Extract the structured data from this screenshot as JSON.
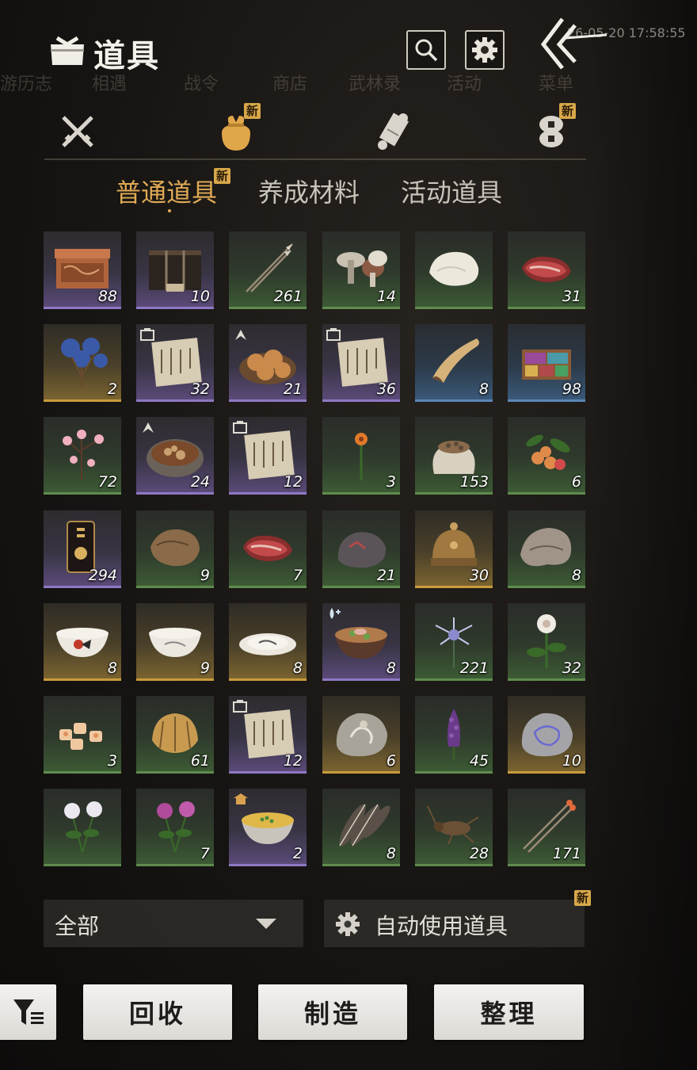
{
  "background": {
    "menu_labels": [
      "游历志",
      "相遇",
      "战令",
      "商店",
      "武林录",
      "活动",
      "菜单"
    ],
    "timestamp": "26-05-20 17:58:55"
  },
  "header": {
    "title": "道具",
    "search_icon": "search-icon",
    "settings_icon": "gear-icon",
    "back_icon": "back-chevron-icon"
  },
  "category_tabs": [
    {
      "icon": "crossed-swords-icon",
      "active": false,
      "badge": ""
    },
    {
      "icon": "pouch-icon",
      "active": true,
      "badge": "新"
    },
    {
      "icon": "scroll-icon",
      "active": false,
      "badge": ""
    },
    {
      "icon": "coins-icon",
      "active": false,
      "badge": "新"
    }
  ],
  "sub_tabs": [
    {
      "label": "普通道具",
      "active": true,
      "badge": "新"
    },
    {
      "label": "养成材料",
      "active": false,
      "badge": ""
    },
    {
      "label": "活动道具",
      "active": false,
      "badge": ""
    }
  ],
  "items": [
    {
      "name": "carved-chest",
      "qty": "88",
      "rarity": "purple",
      "mark": ""
    },
    {
      "name": "dark-chest",
      "qty": "10",
      "rarity": "purple",
      "mark": ""
    },
    {
      "name": "arrows",
      "qty": "261",
      "rarity": "green",
      "mark": ""
    },
    {
      "name": "mushrooms",
      "qty": "14",
      "rarity": "green",
      "mark": ""
    },
    {
      "name": "white-fur",
      "qty": "",
      "rarity": "green",
      "mark": ""
    },
    {
      "name": "raw-meat",
      "qty": "31",
      "rarity": "green",
      "mark": ""
    },
    {
      "name": "blue-flower",
      "qty": "2",
      "rarity": "gold",
      "mark": ""
    },
    {
      "name": "recipe-scroll",
      "qty": "32",
      "rarity": "purple",
      "mark": "recipe"
    },
    {
      "name": "baked-buns",
      "qty": "21",
      "rarity": "purple",
      "mark": "up"
    },
    {
      "name": "recipe-scroll",
      "qty": "36",
      "rarity": "purple",
      "mark": "recipe"
    },
    {
      "name": "horn",
      "qty": "8",
      "rarity": "blue",
      "mark": ""
    },
    {
      "name": "dye-box",
      "qty": "98",
      "rarity": "blue",
      "mark": ""
    },
    {
      "name": "pink-blossom",
      "qty": "72",
      "rarity": "green",
      "mark": ""
    },
    {
      "name": "stew-pot",
      "qty": "24",
      "rarity": "purple",
      "mark": "up"
    },
    {
      "name": "recipe-scroll",
      "qty": "12",
      "rarity": "purple",
      "mark": "recipe"
    },
    {
      "name": "orange-flower",
      "qty": "3",
      "rarity": "green",
      "mark": ""
    },
    {
      "name": "seed-sack",
      "qty": "153",
      "rarity": "green",
      "mark": ""
    },
    {
      "name": "berries",
      "qty": "6",
      "rarity": "green",
      "mark": ""
    },
    {
      "name": "red-token",
      "qty": "294",
      "rarity": "purple",
      "mark": ""
    },
    {
      "name": "brown-fur",
      "qty": "9",
      "rarity": "green",
      "mark": ""
    },
    {
      "name": "raw-meat",
      "qty": "7",
      "rarity": "green",
      "mark": ""
    },
    {
      "name": "ore-rock",
      "qty": "21",
      "rarity": "green",
      "mark": ""
    },
    {
      "name": "bronze-helmet",
      "qty": "30",
      "rarity": "gold",
      "mark": ""
    },
    {
      "name": "grey-pelt",
      "qty": "8",
      "rarity": "green",
      "mark": ""
    },
    {
      "name": "rooster-bowl",
      "qty": "8",
      "rarity": "gold",
      "mark": ""
    },
    {
      "name": "porcelain-bowl",
      "qty": "9",
      "rarity": "gold",
      "mark": ""
    },
    {
      "name": "porcelain-plate",
      "qty": "8",
      "rarity": "gold",
      "mark": ""
    },
    {
      "name": "soup-bowl",
      "qty": "8",
      "rarity": "purple",
      "mark": "drop"
    },
    {
      "name": "blue-spider-lily",
      "qty": "221",
      "rarity": "green",
      "mark": ""
    },
    {
      "name": "white-flower",
      "qty": "32",
      "rarity": "green",
      "mark": ""
    },
    {
      "name": "candy-pieces",
      "qty": "3",
      "rarity": "green",
      "mark": ""
    },
    {
      "name": "gold-shell",
      "qty": "61",
      "rarity": "green",
      "mark": ""
    },
    {
      "name": "recipe-scroll",
      "qty": "12",
      "rarity": "purple",
      "mark": "recipe"
    },
    {
      "name": "fossil-stone",
      "qty": "6",
      "rarity": "gold",
      "mark": ""
    },
    {
      "name": "purple-herb",
      "qty": "45",
      "rarity": "green",
      "mark": ""
    },
    {
      "name": "blue-fossil",
      "qty": "10",
      "rarity": "gold",
      "mark": ""
    },
    {
      "name": "white-chrysanthemum",
      "qty": "",
      "rarity": "green",
      "mark": ""
    },
    {
      "name": "purple-chrysanthemum",
      "qty": "7",
      "rarity": "green",
      "mark": ""
    },
    {
      "name": "egg-soup",
      "qty": "2",
      "rarity": "purple",
      "mark": "house"
    },
    {
      "name": "feathers",
      "qty": "8",
      "rarity": "green",
      "mark": ""
    },
    {
      "name": "cricket",
      "qty": "28",
      "rarity": "green",
      "mark": ""
    },
    {
      "name": "fire-arrows",
      "qty": "171",
      "rarity": "green",
      "mark": ""
    }
  ],
  "filter": {
    "selected": "全部",
    "auto_use_label": "自动使用道具",
    "auto_use_badge": "新"
  },
  "buttons": {
    "recycle": "回收",
    "craft": "制造",
    "organize": "整理"
  }
}
